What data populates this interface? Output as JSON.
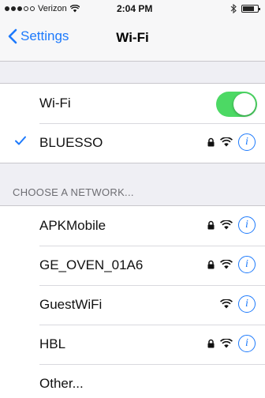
{
  "status_bar": {
    "carrier": "Verizon",
    "time": "2:04 PM",
    "signal_bars_filled": 3,
    "signal_bars_total": 5
  },
  "nav": {
    "back_label": "Settings",
    "title": "Wi-Fi"
  },
  "wifi_toggle": {
    "label": "Wi-Fi",
    "on": true
  },
  "connected_network": {
    "name": "BLUESSO",
    "secured": true,
    "icons": [
      "checkmark-icon",
      "lock-icon",
      "wifi-icon",
      "info-icon"
    ]
  },
  "section_header": "CHOOSE A NETWORK...",
  "networks": [
    {
      "name": "APKMobile",
      "secured": true
    },
    {
      "name": "GE_OVEN_01A6",
      "secured": true
    },
    {
      "name": "GuestWiFi",
      "secured": false
    },
    {
      "name": "HBL",
      "secured": true
    }
  ],
  "other_label": "Other...",
  "colors": {
    "accent": "#1d7afc",
    "toggle_on": "#4cd964",
    "background": "#efeff4"
  }
}
